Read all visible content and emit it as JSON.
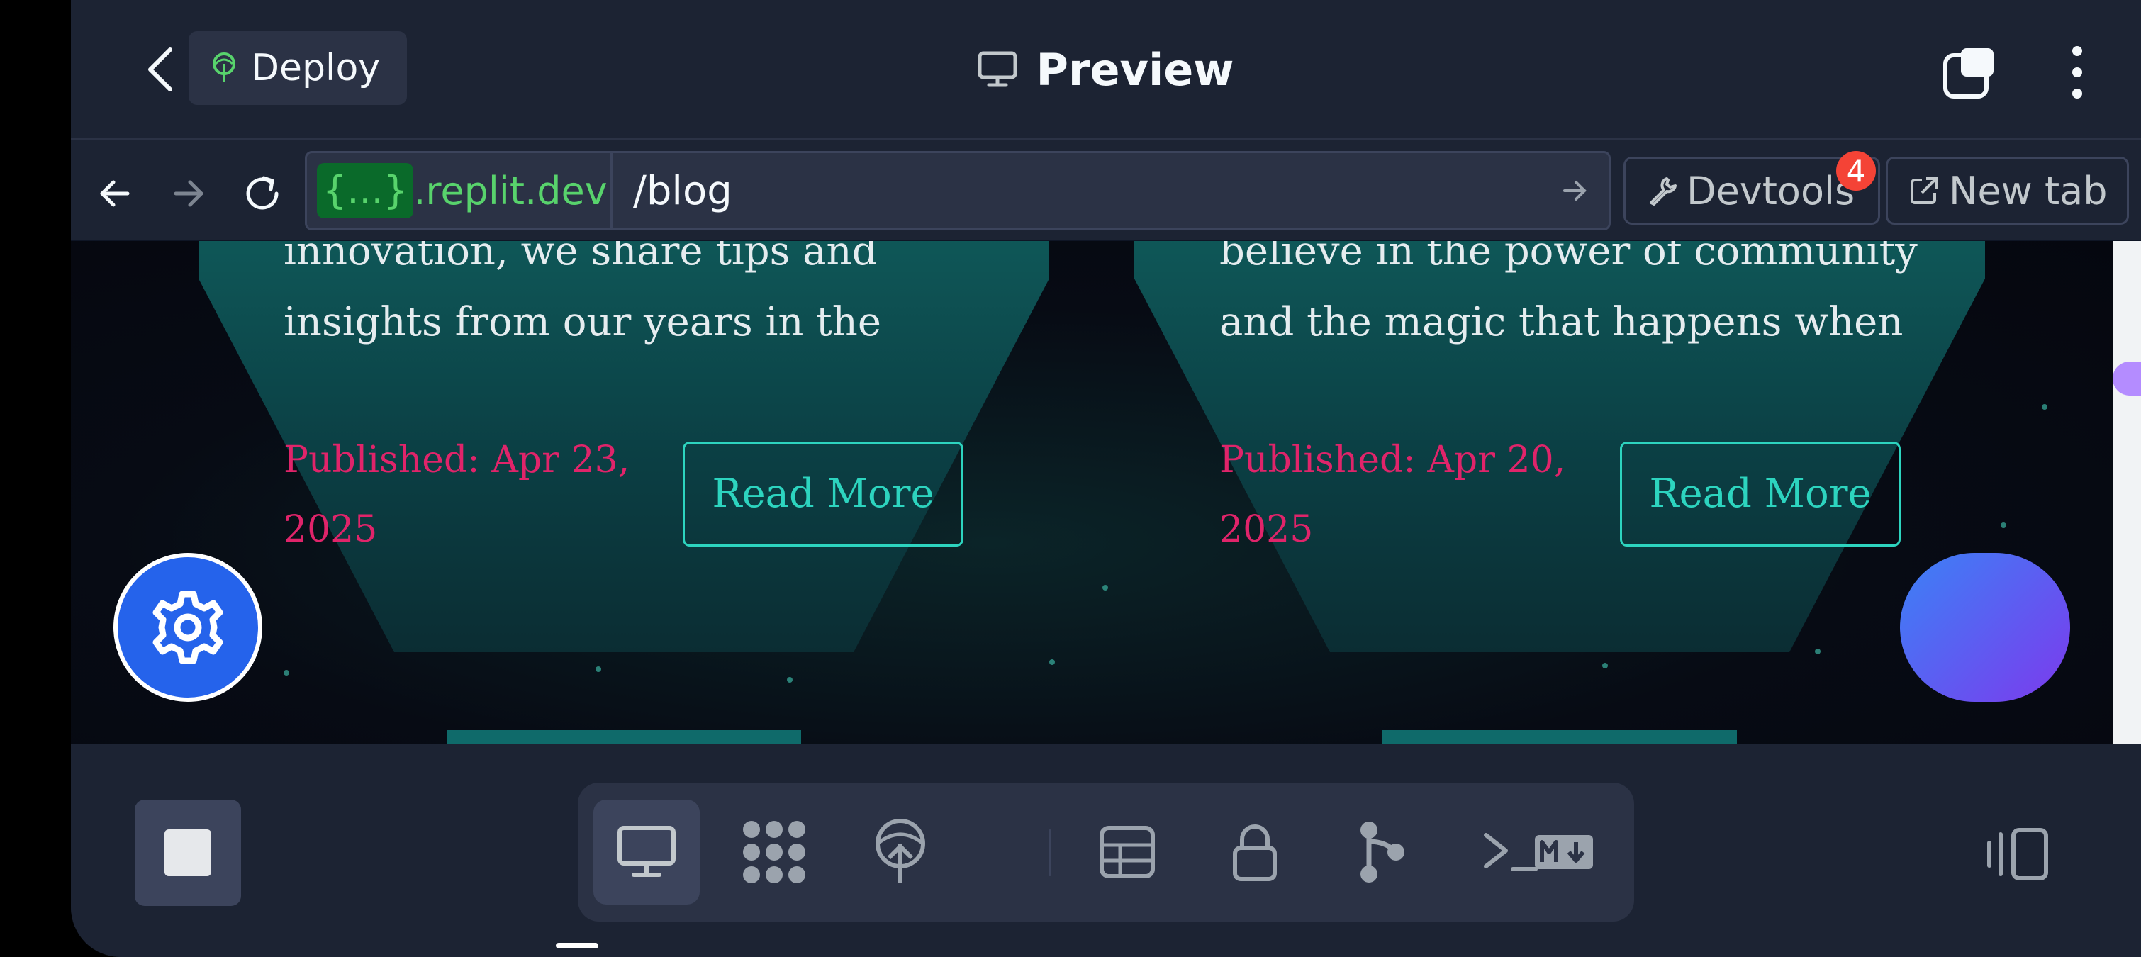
{
  "header": {
    "deploy_label": "Deploy",
    "title": "Preview"
  },
  "urlbar": {
    "host_braces": "{...}",
    "host_domain": ".replit.dev",
    "path": "/blog",
    "devtools_label": "Devtools",
    "devtools_badge": "4",
    "newtab_label": "New tab"
  },
  "cards": [
    {
      "text_lines": [
        "innovation, we share tips and",
        "insights from our years in the"
      ],
      "published": "Published: Apr 23, 2025",
      "read_more": "Read More"
    },
    {
      "text_lines": [
        "believe in the power of community",
        "and the magic that happens when"
      ],
      "published": "Published: Apr 20, 2025",
      "read_more": "Read More"
    }
  ],
  "toolbar": {
    "tools": [
      "preview-icon",
      "integrations-icon",
      "deploy-icon",
      "database-icon",
      "secrets-icon",
      "git-icon",
      "shell-icon",
      "markdown-icon"
    ]
  },
  "colors": {
    "app_bg": "#1c2333",
    "accent_green": "#58d36c",
    "published_pink": "#e0246a",
    "teal": "#2dd4bf",
    "badge_red": "#f44336",
    "fab_blue": "#2563eb"
  }
}
